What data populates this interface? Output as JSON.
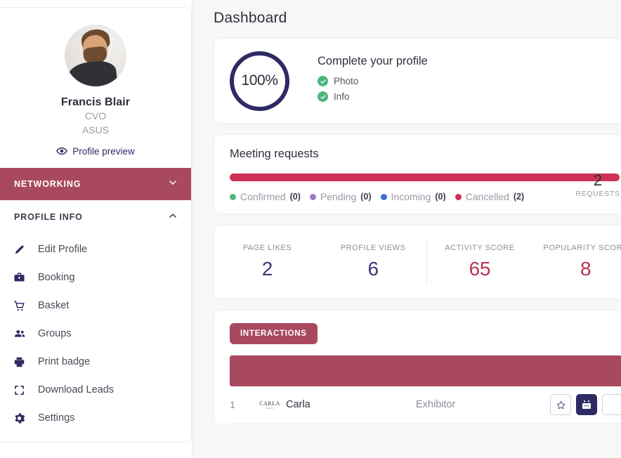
{
  "sidebar": {
    "profile": {
      "avatar_alt": "Francis Blair avatar",
      "name": "Francis Blair",
      "role": "CVO",
      "organization": "ASUS",
      "preview_label": "Profile preview",
      "preview_icon": "eye-icon"
    },
    "sections": [
      {
        "label": "NETWORKING",
        "icon": "chevron-down-icon",
        "expanded": false
      },
      {
        "label": "PROFILE INFO",
        "icon": "chevron-up-icon",
        "expanded": true
      }
    ],
    "menu_items": [
      {
        "label": "Edit Profile",
        "icon": "pencil-icon"
      },
      {
        "label": "Booking",
        "icon": "briefcase-star-icon"
      },
      {
        "label": "Basket",
        "icon": "shopping-cart-icon"
      },
      {
        "label": "Groups",
        "icon": "people-icon"
      },
      {
        "label": "Print badge",
        "icon": "printer-icon"
      },
      {
        "label": "Download Leads",
        "icon": "scan-brackets-icon"
      },
      {
        "label": "Settings",
        "icon": "gear-icon"
      }
    ]
  },
  "main": {
    "page_title": "Dashboard",
    "profile_completion": {
      "percent_label": "100%",
      "percent_value": 100,
      "title": "Complete your profile",
      "items": [
        {
          "label": "Photo",
          "done": true,
          "icon": "check-circle-icon"
        },
        {
          "label": "Info",
          "done": true,
          "icon": "check-circle-icon"
        }
      ]
    },
    "meeting_requests": {
      "title": "Meeting requests",
      "total_value": "2",
      "total_caption": "REQUESTS",
      "legend": [
        {
          "name": "Confirmed",
          "count": "(0)",
          "value": 0,
          "color": "#4cb57f"
        },
        {
          "name": "Pending",
          "count": "(0)",
          "value": 0,
          "color": "#9b7fc4"
        },
        {
          "name": "Incoming",
          "count": "(0)",
          "value": 0,
          "color": "#3f6fd8"
        },
        {
          "name": "Cancelled",
          "count": "(2)",
          "value": 2,
          "color": "#cc3355"
        }
      ]
    },
    "stats": [
      {
        "caption": "PAGE LIKES",
        "value": "2",
        "color": "#3a3a7a"
      },
      {
        "caption": "PROFILE VIEWS",
        "value": "6",
        "color": "#3a3a7a"
      },
      {
        "caption": "ACTIVITY SCORE",
        "value": "65",
        "color": "#b8374f"
      },
      {
        "caption": "POPULARITY SCORE",
        "value": "8",
        "color": "#b8374f"
      }
    ],
    "interactions": {
      "tab_label": "INTERACTIONS",
      "columns": [
        "",
        "",
        "",
        ""
      ],
      "rows": [
        {
          "index": "1",
          "logo_line1": "CARLA",
          "logo_line2": "PARIS",
          "name": "Carla",
          "type": "Exhibitor",
          "actions": [
            {
              "icon": "star-outline-icon",
              "style": "outline"
            },
            {
              "icon": "calendar-icon",
              "style": "solid"
            },
            {
              "icon": "partial-icon",
              "style": "outline"
            }
          ]
        }
      ]
    }
  },
  "colors": {
    "brand_mauve": "#a9495f",
    "brand_crimson": "#cc3355",
    "navy": "#2e2a63",
    "page_bg": "#f7f7f8",
    "card_bg": "#ffffff"
  }
}
